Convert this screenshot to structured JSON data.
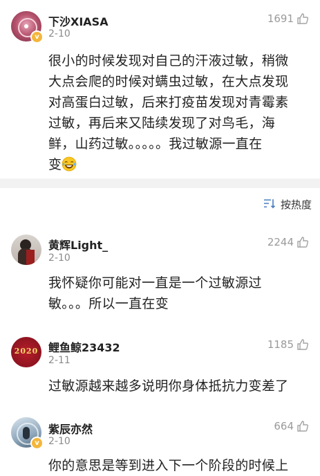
{
  "post": {
    "username": "下沙XIASA",
    "date": "2-10",
    "likes": "1691",
    "text_lines": [
      "很小的时候发现对自己的汗液过敏，稍微",
      "大点会爬的时候对螨虫过敏，在大点发现",
      "对高蛋白过敏，后来打疫苗发现对青霉素",
      "过敏，再后来又陆续发现了对鸟毛，海",
      "鲜，山药过敏。。。。。我过敏源一直在",
      "变"
    ],
    "verified": "v"
  },
  "sort": {
    "label": "按热度"
  },
  "comments": [
    {
      "username": "黄辉Light_",
      "date": "2-10",
      "likes": "2244",
      "text_lines": [
        "我怀疑你可能对一直是一个过敏源过",
        "敏。。。所以一直在变"
      ]
    },
    {
      "username": "鲤鱼鲸23432",
      "date": "2-11",
      "likes": "1185",
      "avatar_text": "2020",
      "text_lines": [
        "过敏源越来越多说明你身体抵抗力变差了"
      ]
    },
    {
      "username": "紫辰亦然",
      "date": "2-10",
      "likes": "664",
      "verified": "v",
      "text_lines": [
        "你的意思是等到进入下一个阶段的时候上"
      ]
    }
  ],
  "colors": {
    "divider": "#f2f2f2",
    "badge": "#f4b63b",
    "muted": "#8a8a8a"
  }
}
